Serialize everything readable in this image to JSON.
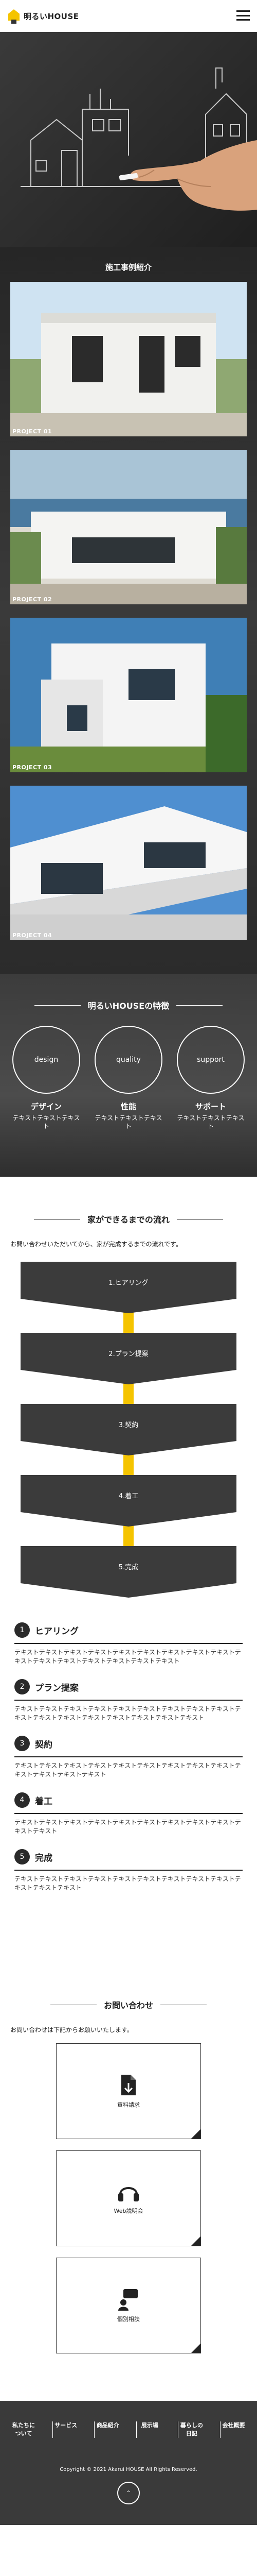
{
  "header": {
    "logo_text": "明るいHOUSE",
    "menu_icon": "hamburger-icon"
  },
  "projects": {
    "title": "施工事例紹介",
    "items": [
      {
        "label": "PROJECT 01"
      },
      {
        "label": "PROJECT 02"
      },
      {
        "label": "PROJECT 03"
      },
      {
        "label": "PROJECT 04"
      }
    ]
  },
  "features": {
    "title": "明るいHOUSEの特徴",
    "items": [
      {
        "circle": "design",
        "title": "デザイン",
        "text": "テキストテキストテキスト"
      },
      {
        "circle": "quality",
        "title": "性能",
        "text": "テキストテキストテキスト"
      },
      {
        "circle": "support",
        "title": "サポート",
        "text": "テキストテキストテキスト"
      }
    ]
  },
  "flow": {
    "title": "家ができるまでの流れ",
    "intro": "お問い合わせいただいてから、家が完成するまでの流れです。",
    "steps": [
      {
        "chevron": "1.ヒアリング",
        "num": "1",
        "title": "ヒアリング",
        "text": "テキストテキストテキストテキストテキストテキストテキストテキストテキストテキストテキストテキストテキストテキストテキストテキスト"
      },
      {
        "chevron": "2.プラン提案",
        "num": "2",
        "title": "プラン提案",
        "text": "テキストテキストテキストテキストテキストテキストテキストテキストテキストテキストテキストテキストテキストテキストテキストテキストテキスト"
      },
      {
        "chevron": "3.契約",
        "num": "3",
        "title": "契約",
        "text": "テキストテキストテキストテキストテキストテキストテキストテキストテキストテキストテキストテキストテキスト"
      },
      {
        "chevron": "4.着工",
        "num": "4",
        "title": "着工",
        "text": "テキストテキストテキストテキストテキストテキストテキストテキストテキストテキストテキスト"
      },
      {
        "chevron": "5.完成",
        "num": "5",
        "title": "完成",
        "text": "テキストテキストテキストテキストテキストテキストテキストテキストテキストテキストテキストテキスト"
      }
    ]
  },
  "contact": {
    "title": "お問い合わせ",
    "intro": "お問い合わせは下記からお願いいたします。",
    "cards": [
      {
        "label": "資料請求",
        "icon": "document-icon"
      },
      {
        "label": "Web説明会",
        "icon": "headset-icon"
      },
      {
        "label": "個別相談",
        "icon": "consultation-icon"
      }
    ]
  },
  "footer": {
    "nav": [
      "私たちについて",
      "サービス",
      "商品紹介",
      "展示場",
      "暮らしの日記",
      "会社概要"
    ],
    "copyright": "Copyright © 2021 Akarui HOUSE All Rights Reserved.",
    "top_label": "TOP"
  },
  "colors": {
    "accent": "#f5c400",
    "dark": "#3a3a3a"
  }
}
